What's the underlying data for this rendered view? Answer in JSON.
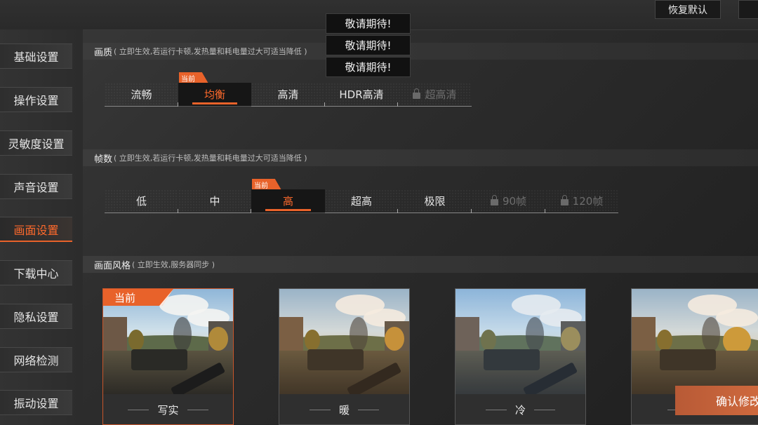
{
  "header": {
    "restore_default": "恢复默认"
  },
  "sidebar": {
    "items": [
      {
        "label": "基础设置",
        "active": false
      },
      {
        "label": "操作设置",
        "active": false
      },
      {
        "label": "灵敏度设置",
        "active": false
      },
      {
        "label": "声音设置",
        "active": false
      },
      {
        "label": "画面设置",
        "active": true
      },
      {
        "label": "下载中心",
        "active": false
      },
      {
        "label": "隐私设置",
        "active": false
      },
      {
        "label": "网络检测",
        "active": false
      },
      {
        "label": "振动设置",
        "active": false
      }
    ]
  },
  "tooltips": [
    "敬请期待!",
    "敬请期待!",
    "敬请期待!"
  ],
  "current_tag": "当前",
  "quality": {
    "title": "画质",
    "note": "( 立即生效,若运行卡顿,发热量和耗电量过大可适当降低 )",
    "options": [
      {
        "label": "流畅",
        "state": "normal"
      },
      {
        "label": "均衡",
        "state": "active"
      },
      {
        "label": "高清",
        "state": "normal"
      },
      {
        "label": "HDR高清",
        "state": "normal"
      },
      {
        "label": "超高清",
        "state": "locked"
      }
    ]
  },
  "framerate": {
    "title": "帧数",
    "note": "( 立即生效,若运行卡顿,发热量和耗电量过大可适当降低 )",
    "options": [
      {
        "label": "低",
        "state": "normal"
      },
      {
        "label": "中",
        "state": "normal"
      },
      {
        "label": "高",
        "state": "active"
      },
      {
        "label": "超高",
        "state": "normal"
      },
      {
        "label": "极限",
        "state": "normal"
      },
      {
        "label": "90帧",
        "state": "locked"
      },
      {
        "label": "120帧",
        "state": "locked"
      }
    ]
  },
  "style": {
    "title": "画面风格",
    "note": "( 立即生效,服务器同步 )",
    "cards": [
      {
        "label": "写实",
        "active": true,
        "filter": "none"
      },
      {
        "label": "暖",
        "active": false,
        "filter": "warm"
      },
      {
        "label": "冷",
        "active": false,
        "filter": "cold"
      },
      {
        "label": "",
        "active": false,
        "filter": "none"
      }
    ]
  },
  "confirm_label": "确认修改",
  "colors": {
    "accent": "#e8622a",
    "background": "#2a2a2a"
  }
}
